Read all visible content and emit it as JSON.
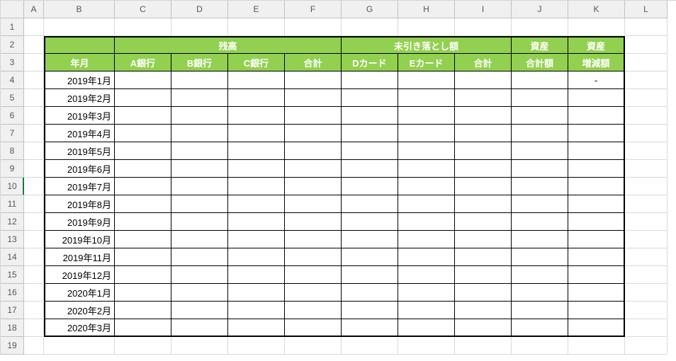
{
  "columns": [
    "A",
    "B",
    "C",
    "D",
    "E",
    "F",
    "G",
    "H",
    "I",
    "J",
    "K",
    "L"
  ],
  "row_count": 19,
  "header": {
    "group_balance": "残高",
    "group_pending": "未引き落とし額",
    "group_asset1": "資産",
    "group_asset2": "資産",
    "col_month": "年月",
    "col_bank_a": "A銀行",
    "col_bank_b": "B銀行",
    "col_bank_c": "C銀行",
    "col_total1": "合計",
    "col_card_d": "Dカード",
    "col_card_e": "Eカード",
    "col_total2": "合計",
    "col_asset_total": "合計額",
    "col_asset_delta": "増減額"
  },
  "rows": [
    {
      "month": "2019年1月",
      "bank_a": "",
      "bank_b": "",
      "bank_c": "",
      "total1": "",
      "card_d": "",
      "card_e": "",
      "total2": "",
      "asset_total": "",
      "asset_delta": "-"
    },
    {
      "month": "2019年2月",
      "bank_a": "",
      "bank_b": "",
      "bank_c": "",
      "total1": "",
      "card_d": "",
      "card_e": "",
      "total2": "",
      "asset_total": "",
      "asset_delta": ""
    },
    {
      "month": "2019年3月",
      "bank_a": "",
      "bank_b": "",
      "bank_c": "",
      "total1": "",
      "card_d": "",
      "card_e": "",
      "total2": "",
      "asset_total": "",
      "asset_delta": ""
    },
    {
      "month": "2019年4月",
      "bank_a": "",
      "bank_b": "",
      "bank_c": "",
      "total1": "",
      "card_d": "",
      "card_e": "",
      "total2": "",
      "asset_total": "",
      "asset_delta": ""
    },
    {
      "month": "2019年5月",
      "bank_a": "",
      "bank_b": "",
      "bank_c": "",
      "total1": "",
      "card_d": "",
      "card_e": "",
      "total2": "",
      "asset_total": "",
      "asset_delta": ""
    },
    {
      "month": "2019年6月",
      "bank_a": "",
      "bank_b": "",
      "bank_c": "",
      "total1": "",
      "card_d": "",
      "card_e": "",
      "total2": "",
      "asset_total": "",
      "asset_delta": ""
    },
    {
      "month": "2019年7月",
      "bank_a": "",
      "bank_b": "",
      "bank_c": "",
      "total1": "",
      "card_d": "",
      "card_e": "",
      "total2": "",
      "asset_total": "",
      "asset_delta": ""
    },
    {
      "month": "2019年8月",
      "bank_a": "",
      "bank_b": "",
      "bank_c": "",
      "total1": "",
      "card_d": "",
      "card_e": "",
      "total2": "",
      "asset_total": "",
      "asset_delta": ""
    },
    {
      "month": "2019年9月",
      "bank_a": "",
      "bank_b": "",
      "bank_c": "",
      "total1": "",
      "card_d": "",
      "card_e": "",
      "total2": "",
      "asset_total": "",
      "asset_delta": ""
    },
    {
      "month": "2019年10月",
      "bank_a": "",
      "bank_b": "",
      "bank_c": "",
      "total1": "",
      "card_d": "",
      "card_e": "",
      "total2": "",
      "asset_total": "",
      "asset_delta": ""
    },
    {
      "month": "2019年11月",
      "bank_a": "",
      "bank_b": "",
      "bank_c": "",
      "total1": "",
      "card_d": "",
      "card_e": "",
      "total2": "",
      "asset_total": "",
      "asset_delta": ""
    },
    {
      "month": "2019年12月",
      "bank_a": "",
      "bank_b": "",
      "bank_c": "",
      "total1": "",
      "card_d": "",
      "card_e": "",
      "total2": "",
      "asset_total": "",
      "asset_delta": ""
    },
    {
      "month": "2020年1月",
      "bank_a": "",
      "bank_b": "",
      "bank_c": "",
      "total1": "",
      "card_d": "",
      "card_e": "",
      "total2": "",
      "asset_total": "",
      "asset_delta": ""
    },
    {
      "month": "2020年2月",
      "bank_a": "",
      "bank_b": "",
      "bank_c": "",
      "total1": "",
      "card_d": "",
      "card_e": "",
      "total2": "",
      "asset_total": "",
      "asset_delta": ""
    },
    {
      "month": "2020年3月",
      "bank_a": "",
      "bank_b": "",
      "bank_c": "",
      "total1": "",
      "card_d": "",
      "card_e": "",
      "total2": "",
      "asset_total": "",
      "asset_delta": ""
    }
  ],
  "colors": {
    "header_fill": "#92d050",
    "header_text": "#ffffff",
    "grid_line": "#d9d9d9",
    "frame": "#000000"
  }
}
